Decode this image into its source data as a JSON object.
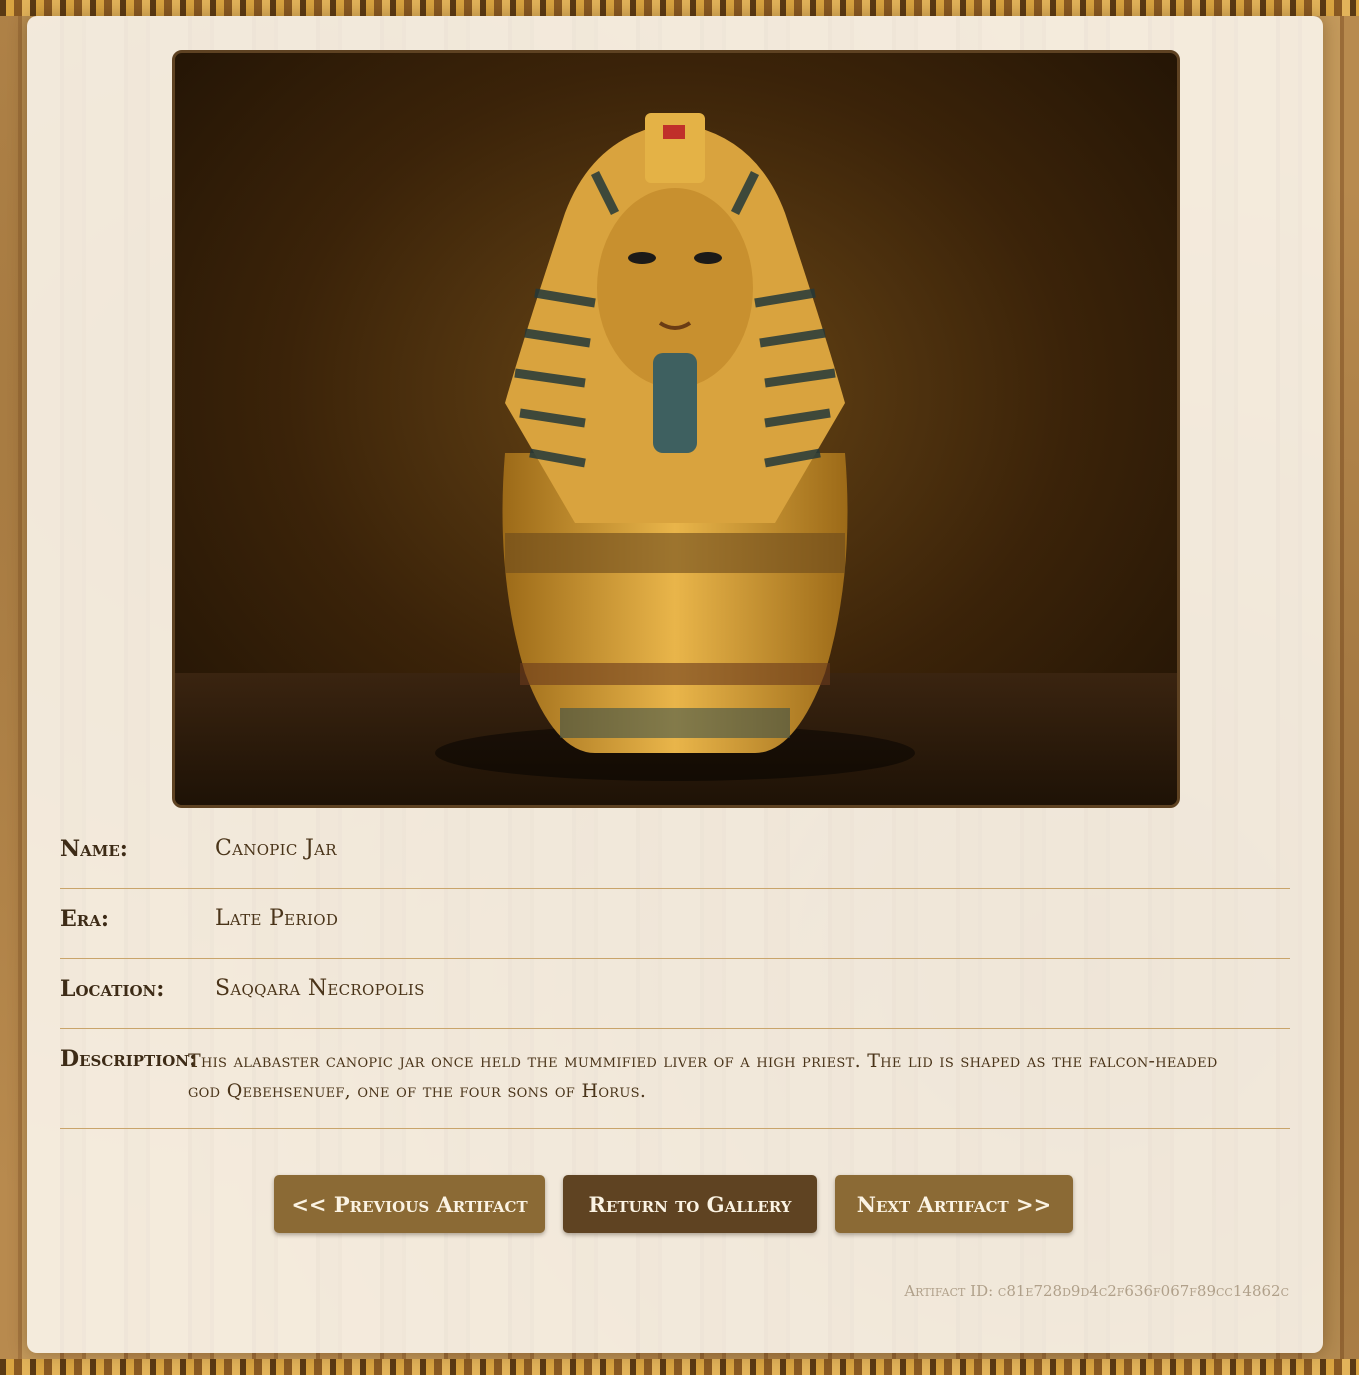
{
  "artifact": {
    "image_alt": "Canopic jar with pharaoh head lid",
    "fields": {
      "name_label": "Name:",
      "name_value": "Canopic Jar",
      "era_label": "Era:",
      "era_value": "Late Period",
      "location_label": "Location:",
      "location_value": "Saqqara Necropolis",
      "description_label": "Description:",
      "description_value": "This alabaster canopic jar once held the mummified liver of a high priest. The lid is shaped as the falcon-headed god Qebehsenuef, one of the four sons of Horus."
    },
    "id_text": "Artifact ID: c81e728d9d4c2f636f067f89cc14862c"
  },
  "navigation": {
    "prev_label": "<< Previous Artifact",
    "gallery_label": "Return to Gallery",
    "next_label": "Next Artifact >>"
  },
  "colors": {
    "accent": "#8b6a35",
    "accent_dark": "#5f4322",
    "text": "#3d2b16",
    "divider": "#c9a46a"
  }
}
